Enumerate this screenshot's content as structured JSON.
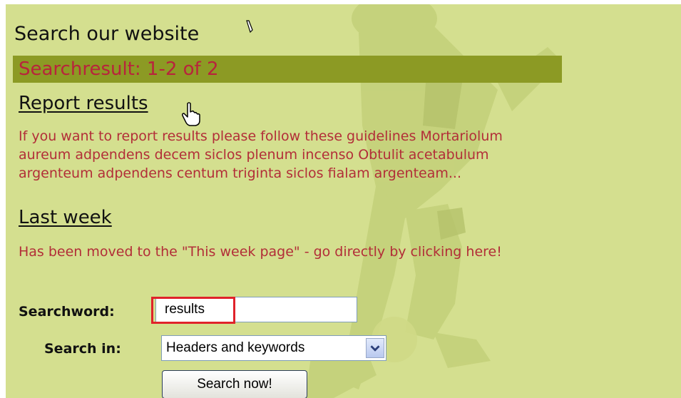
{
  "page": {
    "title": "Search our website",
    "result_summary": "Searchresult: 1-2 of 2"
  },
  "results": [
    {
      "title": "Report results",
      "text": "If you want to report results please follow these guidelines Mortariolum\naureum adpendens decem siclos plenum incenso Obtulit acetabulum\nargenteum adpendens centum triginta siclos fialam argenteam..."
    },
    {
      "title": "Last week",
      "text": "Has been moved to the \"This week page\" - go directly by clicking here!"
    }
  ],
  "form": {
    "searchword_label": "Searchword:",
    "searchword_value": "results",
    "search_in_label": "Search in:",
    "search_in_value": "Headers and keywords",
    "submit_label": "Search now!"
  },
  "colors": {
    "background": "#d4df8f",
    "result_bar": "#8c9a24",
    "result_text": "#b8243c",
    "body_text": "#b22e38",
    "highlight": "#e0222a"
  },
  "icons": [
    "pencil-icon",
    "hand-cursor-icon",
    "chevron-down-icon"
  ]
}
